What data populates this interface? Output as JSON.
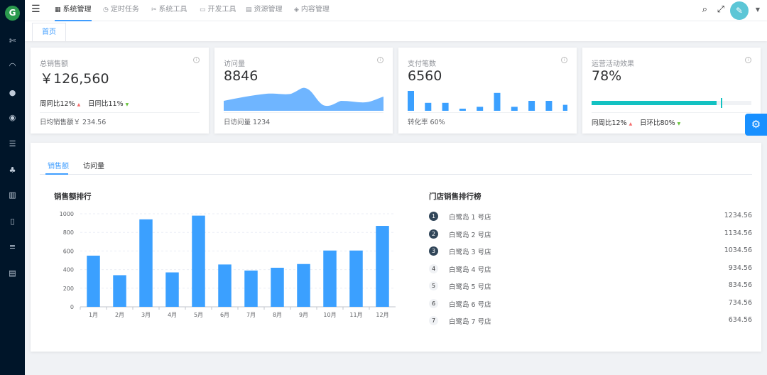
{
  "sidebar": {
    "logo": "G",
    "items": [
      {
        "icon": "tools-icon",
        "glyph": "✄"
      },
      {
        "icon": "dashboard-icon",
        "glyph": "◠"
      },
      {
        "icon": "user-icon",
        "glyph": "●"
      },
      {
        "icon": "users-icon",
        "glyph": "◉"
      },
      {
        "icon": "list-icon",
        "glyph": "☰"
      },
      {
        "icon": "tree-icon",
        "glyph": "♣"
      },
      {
        "icon": "chart-icon",
        "glyph": "▥"
      },
      {
        "icon": "book-icon",
        "glyph": "▯"
      },
      {
        "icon": "sliders-icon",
        "glyph": "≡"
      },
      {
        "icon": "document-icon",
        "glyph": "▤"
      }
    ]
  },
  "header": {
    "menu": [
      {
        "label": "系统管理",
        "glyph": "▦",
        "active": true
      },
      {
        "label": "定时任务",
        "glyph": "◷",
        "active": false
      },
      {
        "label": "系统工具",
        "glyph": "✂",
        "active": false
      },
      {
        "label": "开发工具",
        "glyph": "▭",
        "active": false
      },
      {
        "label": "资源管理",
        "glyph": "▤",
        "active": false
      },
      {
        "label": "内容管理",
        "glyph": "◈",
        "active": false
      }
    ]
  },
  "tabs": {
    "home": "首页"
  },
  "cards": {
    "sales": {
      "title": "总销售额",
      "value": "￥126,560",
      "week_label": "周同比12%",
      "day_label": "日同比11%",
      "footer": "日均销售额￥ 234.56"
    },
    "visits": {
      "title": "访问量",
      "value": "8846",
      "footer": "日访问量 1234"
    },
    "payments": {
      "title": "支付笔数",
      "value": "6560",
      "footer": "转化率 60%",
      "bars": [
        10,
        4,
        4,
        1,
        2,
        9,
        2,
        5,
        5,
        3
      ]
    },
    "ops": {
      "title": "运营活动效果",
      "value": "78%",
      "progress": 0.78,
      "target": 0.81,
      "week_label": "同周比12%",
      "day_label": "日环比80%"
    }
  },
  "panel": {
    "tab_sales": "销售额",
    "tab_visits": "访问量",
    "chart_title": "销售额排行",
    "ranking_title": "门店销售排行榜",
    "ranking": [
      {
        "rank": "1",
        "name": "白鹭岛 1 号店",
        "value": "1234.56"
      },
      {
        "rank": "2",
        "name": "白鹭岛 2 号店",
        "value": "1134.56"
      },
      {
        "rank": "3",
        "name": "白鹭岛 3 号店",
        "value": "1034.56"
      },
      {
        "rank": "4",
        "name": "白鹭岛 4 号店",
        "value": "934.56"
      },
      {
        "rank": "5",
        "name": "白鹭岛 5 号店",
        "value": "834.56"
      },
      {
        "rank": "6",
        "name": "白鹭岛 6 号店",
        "value": "734.56"
      },
      {
        "rank": "7",
        "name": "白鹭岛 7 号店",
        "value": "634.56"
      }
    ]
  },
  "colors": {
    "accent": "#409eff",
    "bar": "#3ba0ff",
    "sidebar": "#001529",
    "progress": "#13c2c2"
  },
  "chart_data": {
    "type": "bar",
    "title": "销售额排行",
    "categories": [
      "1月",
      "2月",
      "3月",
      "4月",
      "5月",
      "6月",
      "7月",
      "8月",
      "9月",
      "10月",
      "11月",
      "12月"
    ],
    "values": [
      550,
      340,
      940,
      370,
      980,
      455,
      390,
      420,
      460,
      605,
      605,
      870
    ],
    "ylim": [
      0,
      1000
    ],
    "yticks": [
      "0",
      "200",
      "400",
      "600",
      "800",
      "1000"
    ],
    "grid": true
  }
}
